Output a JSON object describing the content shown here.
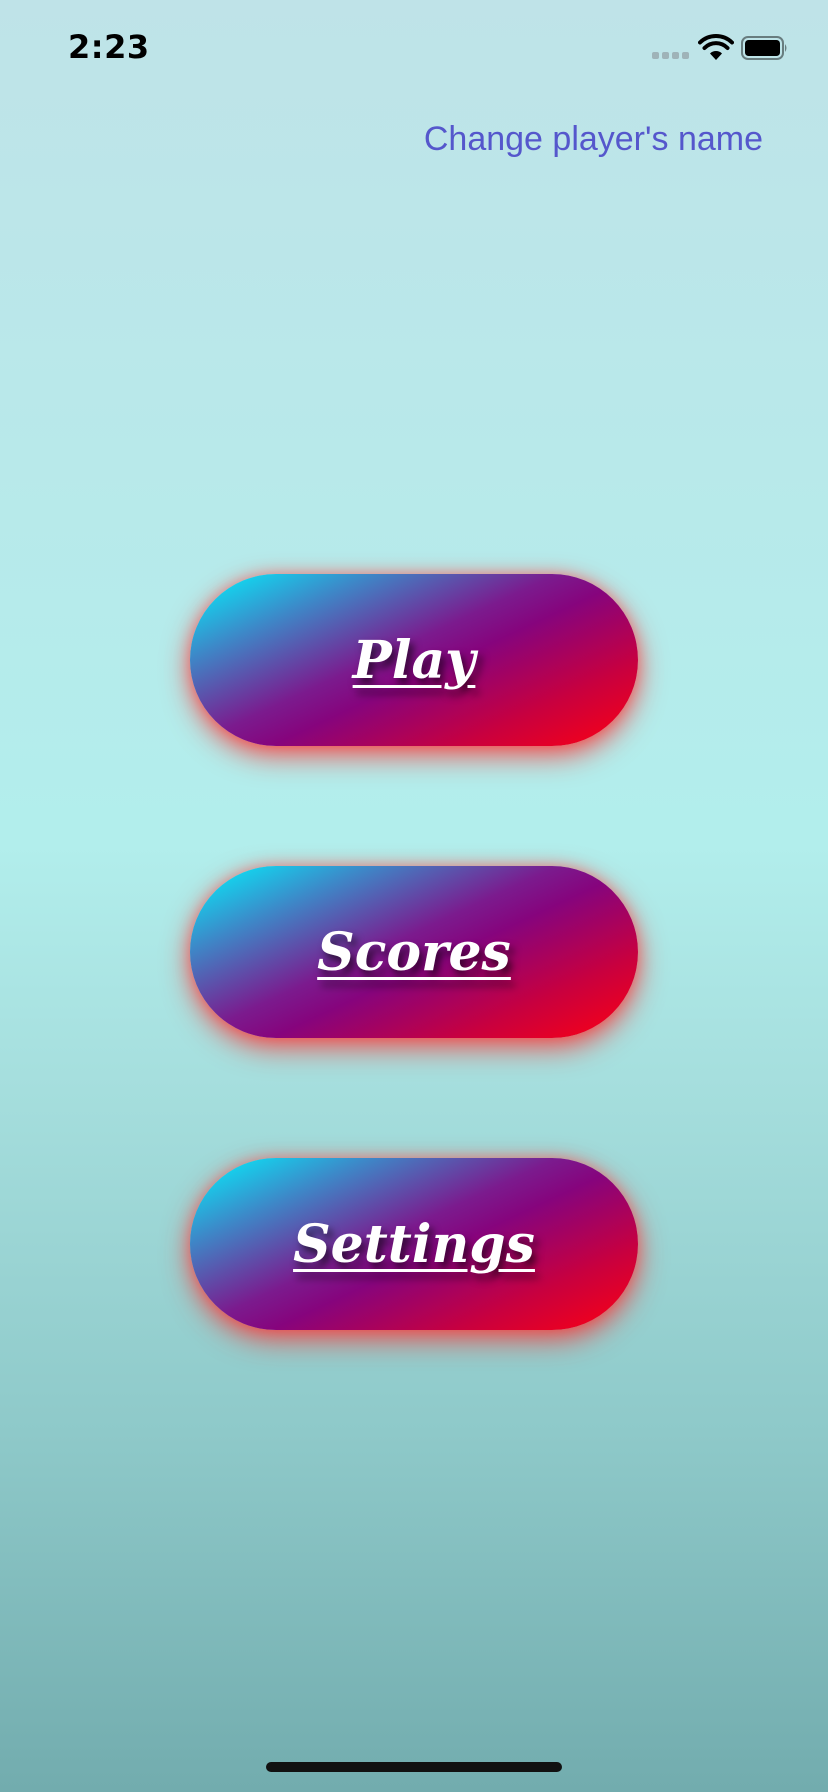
{
  "status_bar": {
    "time": "2:23",
    "icons": [
      "signal-icon",
      "wifi-icon",
      "battery-icon"
    ]
  },
  "header": {
    "change_name_link": "Change player's name"
  },
  "menu": {
    "buttons": [
      {
        "label": "Play"
      },
      {
        "label": "Scores"
      },
      {
        "label": "Settings"
      }
    ]
  },
  "colors": {
    "link": "#5557cc",
    "button_gradient_start": "#00f6ff",
    "button_gradient_mid": "#86047d",
    "button_gradient_end": "#ff0010",
    "button_glow": "#ff2828",
    "background_top": "#bfe3e8",
    "background_bottom": "#72acae"
  }
}
